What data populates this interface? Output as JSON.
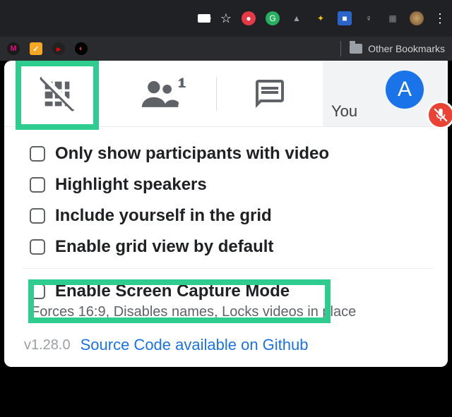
{
  "browser": {
    "bookmarks_label": "Other Bookmarks"
  },
  "tabs": {
    "people_count": "1"
  },
  "participant": {
    "you_label": "You",
    "avatar_initial": "A"
  },
  "options": {
    "opt1": "Only show participants with video",
    "opt2": "Highlight speakers",
    "opt3": "Include yourself in the grid",
    "opt4": "Enable grid view by default",
    "opt5": "Enable Screen Capture Mode",
    "opt5_desc": "Forces 16:9, Disables names, Locks videos in place"
  },
  "footer": {
    "version": "v1.28.0",
    "link": "Source Code available on Github"
  }
}
